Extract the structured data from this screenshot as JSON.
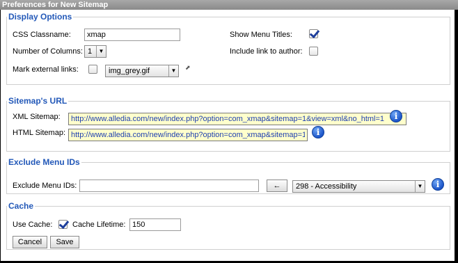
{
  "window": {
    "title": "Preferences for New Sitemap"
  },
  "display": {
    "legend": "Display Options",
    "css_label": "CSS Classname:",
    "css_value": "xmap",
    "columns_label": "Number of Columns:",
    "columns_value": "1",
    "external_label": "Mark external links:",
    "external_checked": false,
    "external_image": "img_grey.gif",
    "show_titles_label": "Show Menu Titles:",
    "show_titles_checked": true,
    "include_link_label": "Include link to author:",
    "include_link_checked": false
  },
  "urls": {
    "legend": "Sitemap's URL",
    "xml_label": "XML Sitemap:",
    "xml_value": "http://www.alledia.com/new/index.php?option=com_xmap&sitemap=1&view=xml&no_html=1",
    "html_label": "HTML Sitemap:",
    "html_value": "http://www.alledia.com/new/index.php?option=com_xmap&sitemap=1"
  },
  "exclude": {
    "legend": "Exclude Menu IDs",
    "label": "Exclude Menu IDs:",
    "value": "",
    "add_button": "←",
    "menu_selected": "298 - Accessibility"
  },
  "cache": {
    "legend": "Cache",
    "use_label": "Use Cache:",
    "use_checked": true,
    "lifetime_label": "Cache Lifetime:",
    "lifetime_value": "150"
  },
  "buttons": {
    "cancel": "Cancel",
    "save": "Save"
  },
  "icons": {
    "info": "info-icon",
    "external": "external-link-icon"
  },
  "colors": {
    "legend": "#2258b8",
    "url_bg": "#ffffcc"
  }
}
